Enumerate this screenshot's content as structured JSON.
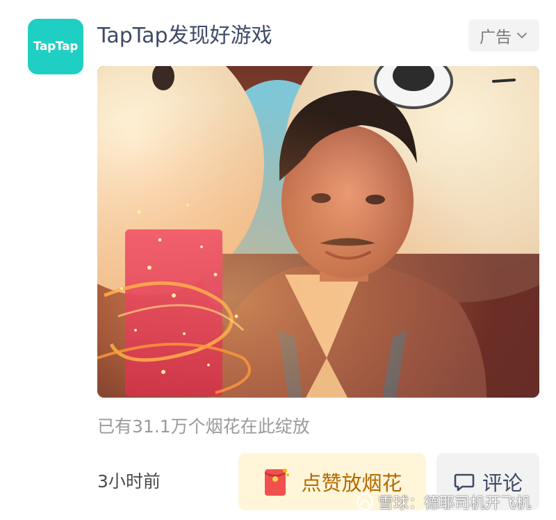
{
  "app": {
    "icon_text": "TapTap",
    "title": "TapTap发现好游戏"
  },
  "ad_tag": {
    "label": "广告",
    "icon": "chevron-down-icon"
  },
  "media": {
    "type": "video-thumbnail"
  },
  "caption": "已有31.1万个烟花在此绽放",
  "footer": {
    "time": "3小时前",
    "like_button": {
      "label": "点赞放烟花",
      "icon": "red-envelope-icon"
    },
    "comment_button": {
      "label": "评论",
      "icon": "comment-icon"
    }
  },
  "watermark": {
    "text": "雪球：德耶司机开飞机",
    "icon": "snowball-logo-icon"
  },
  "colors": {
    "brand_teal": "#1fcfc3",
    "title_text": "#3f4a66",
    "like_bg": "#fff6da",
    "like_text": "#b46a00"
  }
}
